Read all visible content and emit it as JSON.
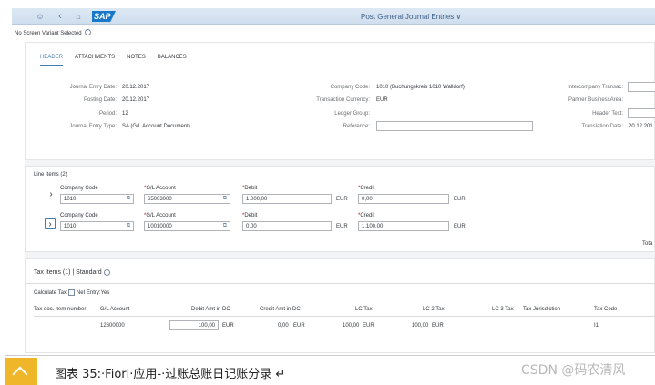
{
  "app": {
    "title": "Post General Journal Entries ∨",
    "logo": "SAP"
  },
  "variant": "No Screen Variant Selected",
  "tabs": [
    "HEADER",
    "ATTACHMENTS",
    "NOTES",
    "BALANCES"
  ],
  "header": {
    "journal_entry_date_label": "Journal Entry Date:",
    "journal_entry_date": "20.12.2017",
    "posting_date_label": "Posting Date:",
    "posting_date": "20.12.2017",
    "period_label": "Period:",
    "period": "12",
    "entry_type_label": "Journal Entry Type:",
    "entry_type": "SA (G/L Account Document)",
    "company_code_label": "Company Code:",
    "company_code": "1010 (Buchungskreis 1010 Walldorf)",
    "transaction_currency_label": "Transaction Currency:",
    "transaction_currency": "EUR",
    "ledger_group_label": "Ledger Group:",
    "reference_label": "Reference:",
    "intercompany_label": "Intercompany Transac:",
    "partner_area_label": "Partner BusinessArea:",
    "header_text_label": "Header Text:",
    "translation_date_label": "Translation Date:",
    "translation_date": "20.12.201"
  },
  "line_items": {
    "title": "Line Items (2)",
    "labels": {
      "company_code": "Company Code",
      "gl_account": "G/L Account",
      "debit": "Debit",
      "credit": "Credit"
    },
    "rows": [
      {
        "company_code": "1010",
        "gl_account": "65003000",
        "debit": "1.000,00",
        "debit_cur": "EUR",
        "credit": "0,00",
        "credit_cur": "EUR"
      },
      {
        "company_code": "1010",
        "gl_account": "10010000",
        "debit": "0,00",
        "debit_cur": "EUR",
        "credit": "1.100,00",
        "credit_cur": "EUR"
      }
    ],
    "total": "Tota"
  },
  "tax_items": {
    "title": "Tax Items (1)",
    "variant": "Standard",
    "calculate_tax": "Calculate Tax",
    "net_entry": "Net Entry:Yes",
    "columns": [
      "Tax doc. item number",
      "G/L Account",
      "Debit Amt in DC",
      "Credit Amt in DC",
      "LC Tax",
      "LC 2 Tax",
      "LC 3 Tax",
      "Tax Jurisdiction",
      "Tax Code"
    ],
    "row": {
      "gl_account": "12600000",
      "debit": "100,00",
      "debit_cur": "EUR",
      "credit": "0,00",
      "credit_cur": "EUR",
      "lc_tax": "100,00",
      "lc_tax_cur": "EUR",
      "lc2_tax": "100,00",
      "lc2_tax_cur": "EUR",
      "tax_code": "I1"
    }
  },
  "caption": "图表 35:·Fiori·应用-·过账总账日记账分录 ↵",
  "watermark": "CSDN @码农清风"
}
